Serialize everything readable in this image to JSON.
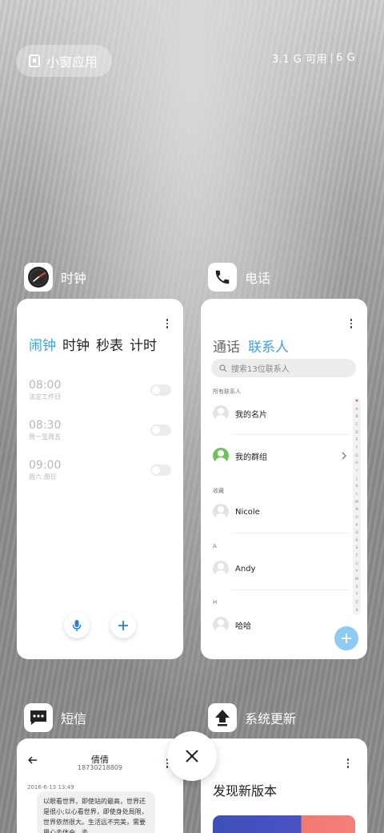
{
  "top": {
    "mini_app_label": "小窗应用",
    "memory_available": "3.1 G 可用",
    "memory_total": "6 G"
  },
  "clock": {
    "app_name": "时钟",
    "tabs": [
      "闹钟",
      "时钟",
      "秒表",
      "计时"
    ],
    "active_tab": "闹钟",
    "alarms": [
      {
        "time": "08:00",
        "label": "法定工作日"
      },
      {
        "time": "08:30",
        "label": "周一至周五"
      },
      {
        "time": "09:00",
        "label": "周六 周日"
      }
    ]
  },
  "phone": {
    "app_name": "电话",
    "tabs": [
      "通话",
      "联系人"
    ],
    "active_tab": "联系人",
    "search_placeholder": "搜索13位联系人",
    "sections": {
      "all": "所有联系人",
      "favorites": "收藏",
      "a": "A",
      "h": "H"
    },
    "contacts": {
      "my_card": "我的名片",
      "my_groups": "我的群组",
      "nicole": "Nicole",
      "andy": "Andy",
      "haha": "哈哈"
    },
    "index_letters": [
      "♥",
      "A",
      "B",
      "C",
      "D",
      "E",
      "F",
      "G",
      "H",
      "I",
      "J",
      "K",
      "L",
      "M",
      "N",
      "O",
      "P",
      "Q",
      "R",
      "S",
      "T",
      "U",
      "V",
      "W",
      "X",
      "Y",
      "Z",
      "#"
    ]
  },
  "sms": {
    "app_name": "短信",
    "contact_name": "倩倩",
    "contact_number": "18730218809",
    "timestamp": "2016-6-13 13:49",
    "message": "以眼看世界，即使站的最高，世界还是很小;以心看世界，即使身处局限，世界依然很大。生活远不完美，需要用心去体会，去"
  },
  "update": {
    "app_name": "系统更新",
    "title": "发现新版本"
  },
  "colors": {
    "accent": "#3aa3e5",
    "fab": "#8ecbf3",
    "group_avatar": "#6cc35a"
  }
}
